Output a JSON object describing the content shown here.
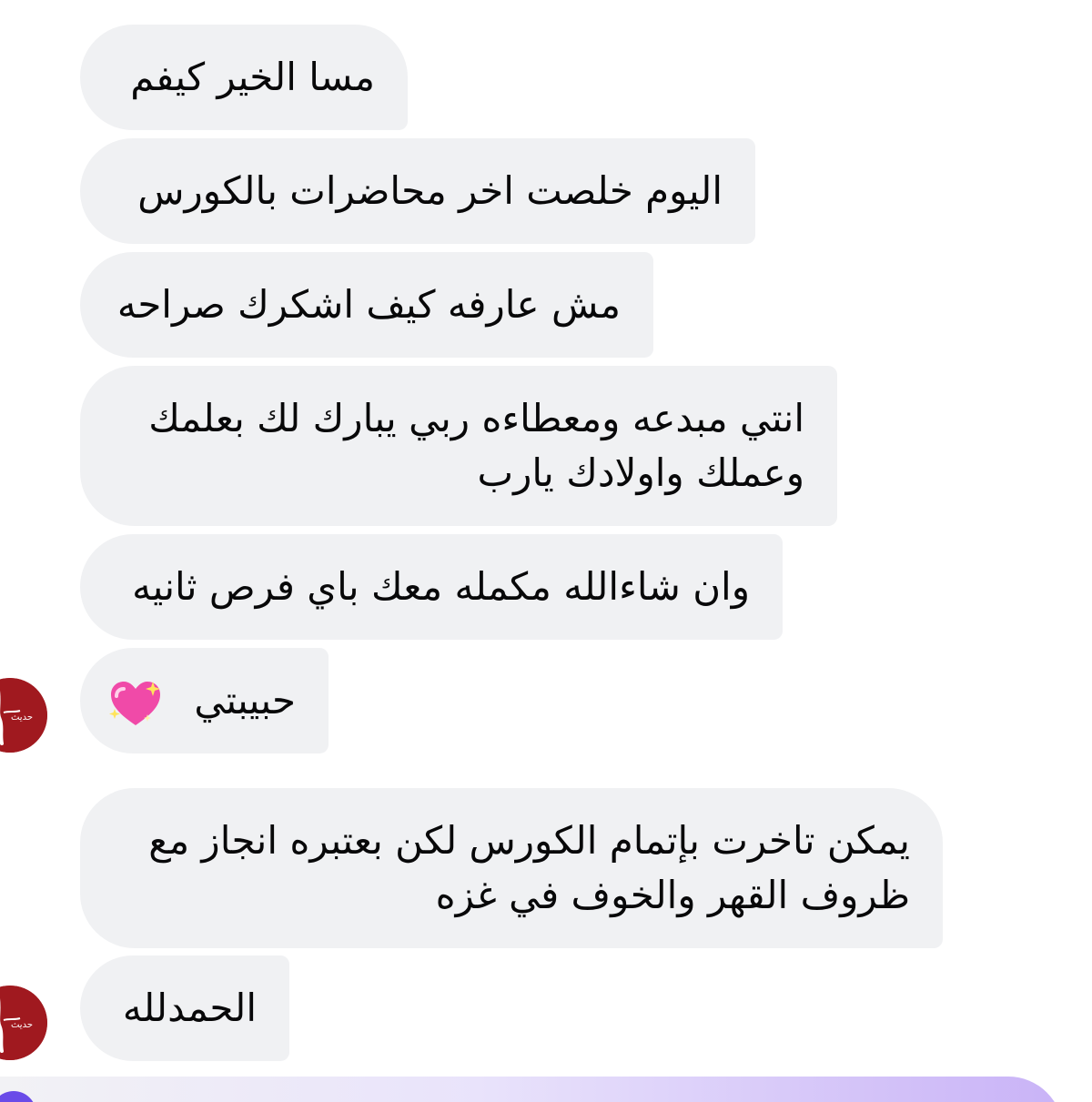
{
  "conversation": {
    "messages": [
      {
        "text": "مسا الخير كيفم"
      },
      {
        "text": "اليوم خلصت اخر محاضرات بالكورس"
      },
      {
        "text": "مش عارفه كيف اشكرك صراحه"
      },
      {
        "text": "انتي مبدعه ومعطاءه ربي يبارك لك بعلمك وعملك واولادك يارب"
      },
      {
        "text": "وان شاءالله مكمله معك باي فرص ثانيه"
      },
      {
        "text": "حبيبتي",
        "emoji": "sparkling-heart-icon"
      },
      {
        "text": "يمكن تاخرت بإتمام الكورس لكن بعتبره انجاز مع ظروف القهر والخوف في غزه"
      },
      {
        "text": "الحمدلله"
      }
    ],
    "sender_avatar": {
      "icon": "sender-avatar-logo",
      "color": "#a0191f",
      "label": "حديث"
    }
  },
  "colors": {
    "bubble_bg": "#f0f1f3",
    "text": "#080809",
    "heart_pink": "#f04aa8",
    "composer_accent": "#c9b3f7"
  }
}
